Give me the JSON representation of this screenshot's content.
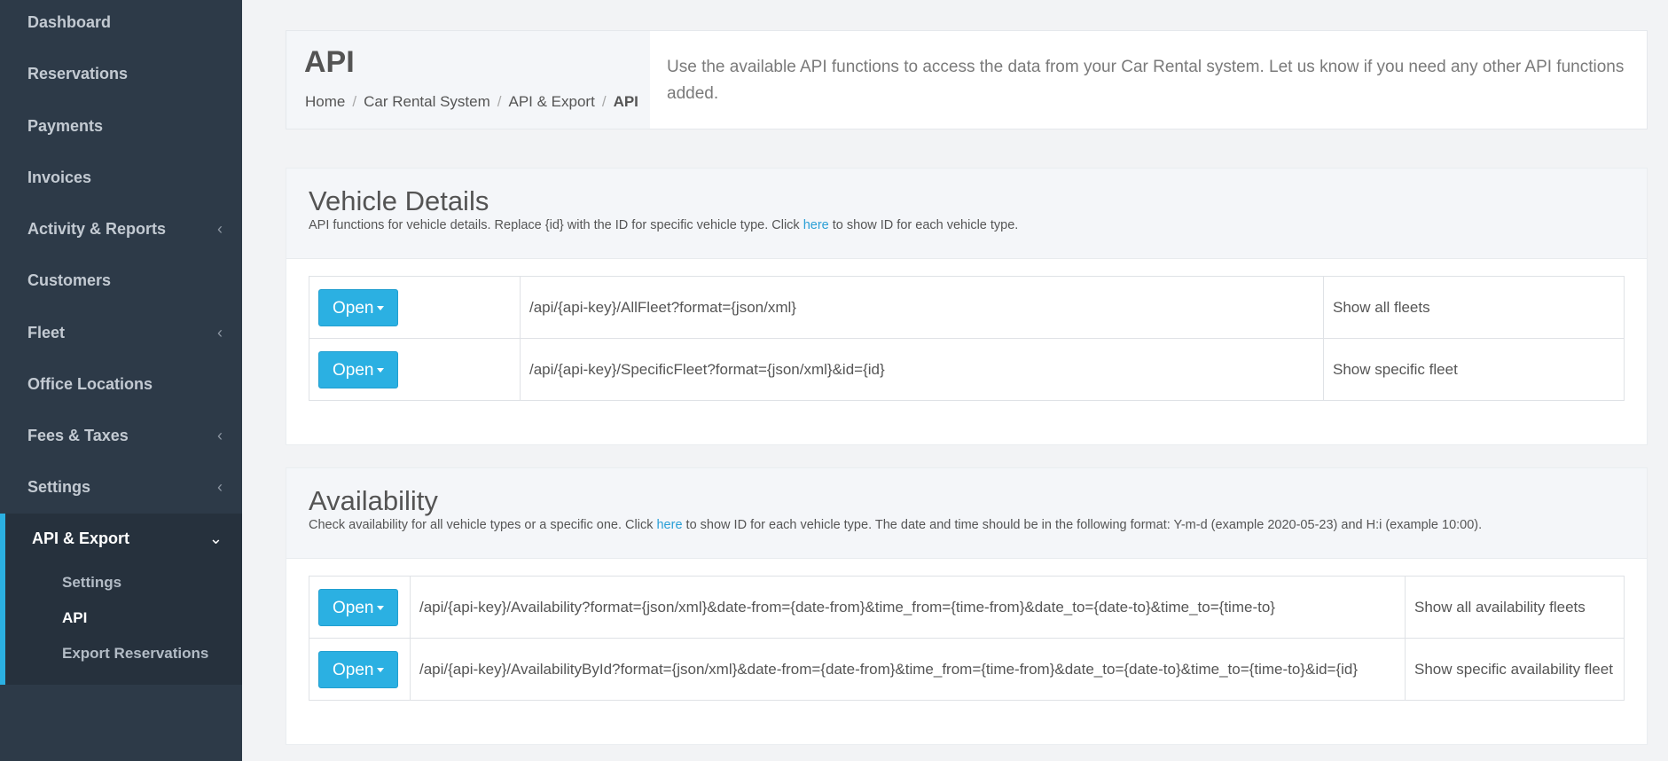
{
  "sidebar": {
    "items": [
      {
        "label": "Dashboard"
      },
      {
        "label": "Reservations"
      },
      {
        "label": "Payments"
      },
      {
        "label": "Invoices"
      },
      {
        "label": "Activity & Reports",
        "chevron": "‹"
      },
      {
        "label": "Customers"
      },
      {
        "label": "Fleet",
        "chevron": "‹"
      },
      {
        "label": "Office Locations"
      },
      {
        "label": "Fees & Taxes",
        "chevron": "‹"
      },
      {
        "label": "Settings",
        "chevron": "‹"
      },
      {
        "label": "API & Export",
        "chevron": "⌄"
      }
    ],
    "sub_items": [
      {
        "label": "Settings"
      },
      {
        "label": "API"
      },
      {
        "label": "Export Reservations"
      }
    ]
  },
  "header": {
    "title": "API",
    "breadcrumb": [
      "Home",
      "Car Rental System",
      "API & Export",
      "API"
    ],
    "description": "Use the available API functions to access the data from your Car Rental system. Let us know if you need any other API functions added."
  },
  "vehicle_details": {
    "title": "Vehicle Details",
    "subtitle_before": "API functions for vehicle details. Replace {id} with the ID for specific vehicle type. Click ",
    "subtitle_link": "here",
    "subtitle_after": " to show ID for each vehicle type.",
    "rows": [
      {
        "button": "Open",
        "endpoint": "/api/{api-key}/AllFleet?format={json/xml}",
        "description": "Show all fleets"
      },
      {
        "button": "Open",
        "endpoint": "/api/{api-key}/SpecificFleet?format={json/xml}&id={id}",
        "description": "Show specific fleet"
      }
    ]
  },
  "availability": {
    "title": "Availability",
    "subtitle_before": "Check availability for all vehicle types or a specific one. Click ",
    "subtitle_link": "here",
    "subtitle_after": " to show ID for each vehicle type. The date and time should be in the following format: Y-m-d (example 2020-05-23) and H:i (example 10:00).",
    "rows": [
      {
        "button": "Open",
        "endpoint": "/api/{api-key}/Availability?format={json/xml}&date-from={date-from}&time_from={time-from}&date_to={date-to}&time_to={time-to}",
        "description": "Show all availability fleets"
      },
      {
        "button": "Open",
        "endpoint": "/api/{api-key}/AvailabilityById?format={json/xml}&date-from={date-from}&time_from={time-from}&date_to={date-to}&time_to={time-to}&id={id}",
        "description": "Show specific availability fleet"
      }
    ]
  },
  "colors": {
    "sidebar_bg": "#2d3a48",
    "accent": "#2bb0e2",
    "link": "#2a9fd6"
  }
}
